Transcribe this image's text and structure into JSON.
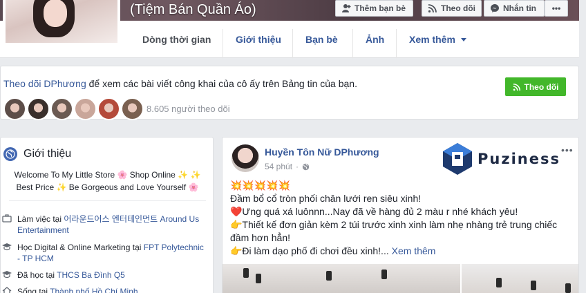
{
  "header": {
    "page_name": "(Tiệm Bán Quần Áo)",
    "buttons": {
      "add_friend": "Thêm bạn bè",
      "follow": "Theo dõi",
      "message": "Nhắn tin",
      "more": "•••"
    }
  },
  "nav": {
    "tabs": [
      {
        "label": "Dòng thời gian",
        "active": true
      },
      {
        "label": "Giới thiệu"
      },
      {
        "label": "Bạn bè"
      },
      {
        "label": "Ảnh"
      },
      {
        "label": "Xem thêm"
      }
    ]
  },
  "follow_box": {
    "link_text": "Theo dõi DPhương",
    "text_rest": " để xem các bài viết công khai của cô ấy trên Bảng tin của bạn.",
    "button": "Theo dõi",
    "follower_count": "8.605 người theo dõi",
    "face_colors": [
      "#5d4e49",
      "#3a2f2b",
      "#6b5a52",
      "#c9a69a",
      "#b44a3a",
      "#7a6050"
    ]
  },
  "intro": {
    "title": "Giới thiệu",
    "bio_line1": "Welcome To My Little Store 🌸 Shop Online ✨ ✨",
    "bio_line2": "Best Price ✨ Be Gorgeous and Love Yourself 🌸",
    "items": [
      {
        "prefix": "Làm việc tại ",
        "link": "어라운드어스 엔터테인먼트 Around Us Entertainment",
        "icon": "briefcase-icon"
      },
      {
        "prefix": "Học Digital & Online Marketing tại ",
        "link": "FPT Polytechnic - TP HCM",
        "icon": "graduation-cap-icon"
      },
      {
        "prefix": "Đã học tại ",
        "link": "THCS Ba Đình Q5",
        "icon": "graduation-cap-icon"
      },
      {
        "prefix": "Sống tại ",
        "link": "Thành phố Hồ Chí Minh",
        "icon": "home-icon"
      }
    ]
  },
  "post": {
    "author": "Huyền Tôn Nữ DPhương",
    "time": "54 phút",
    "more": "•••",
    "watermark": "Puziness",
    "lines": [
      "💥💥💥💥💥",
      "Đầm bổ cổ tròn phối chân lưới ren siêu xinh!",
      "❤️Ưng quá xá luônnn...Nay đã về hàng đủ 2 màu r nhé khách yêu!",
      "👉Thiết kế đơn giản kèm 2 túi trước xinh xinh làm nhẹ nhàng trẻ trung chiếc đầm hơn hẳn!"
    ],
    "last_line": "👉Đi làm dạo phố đi chơi đều xinh!...",
    "see_more": "Xem thêm"
  }
}
